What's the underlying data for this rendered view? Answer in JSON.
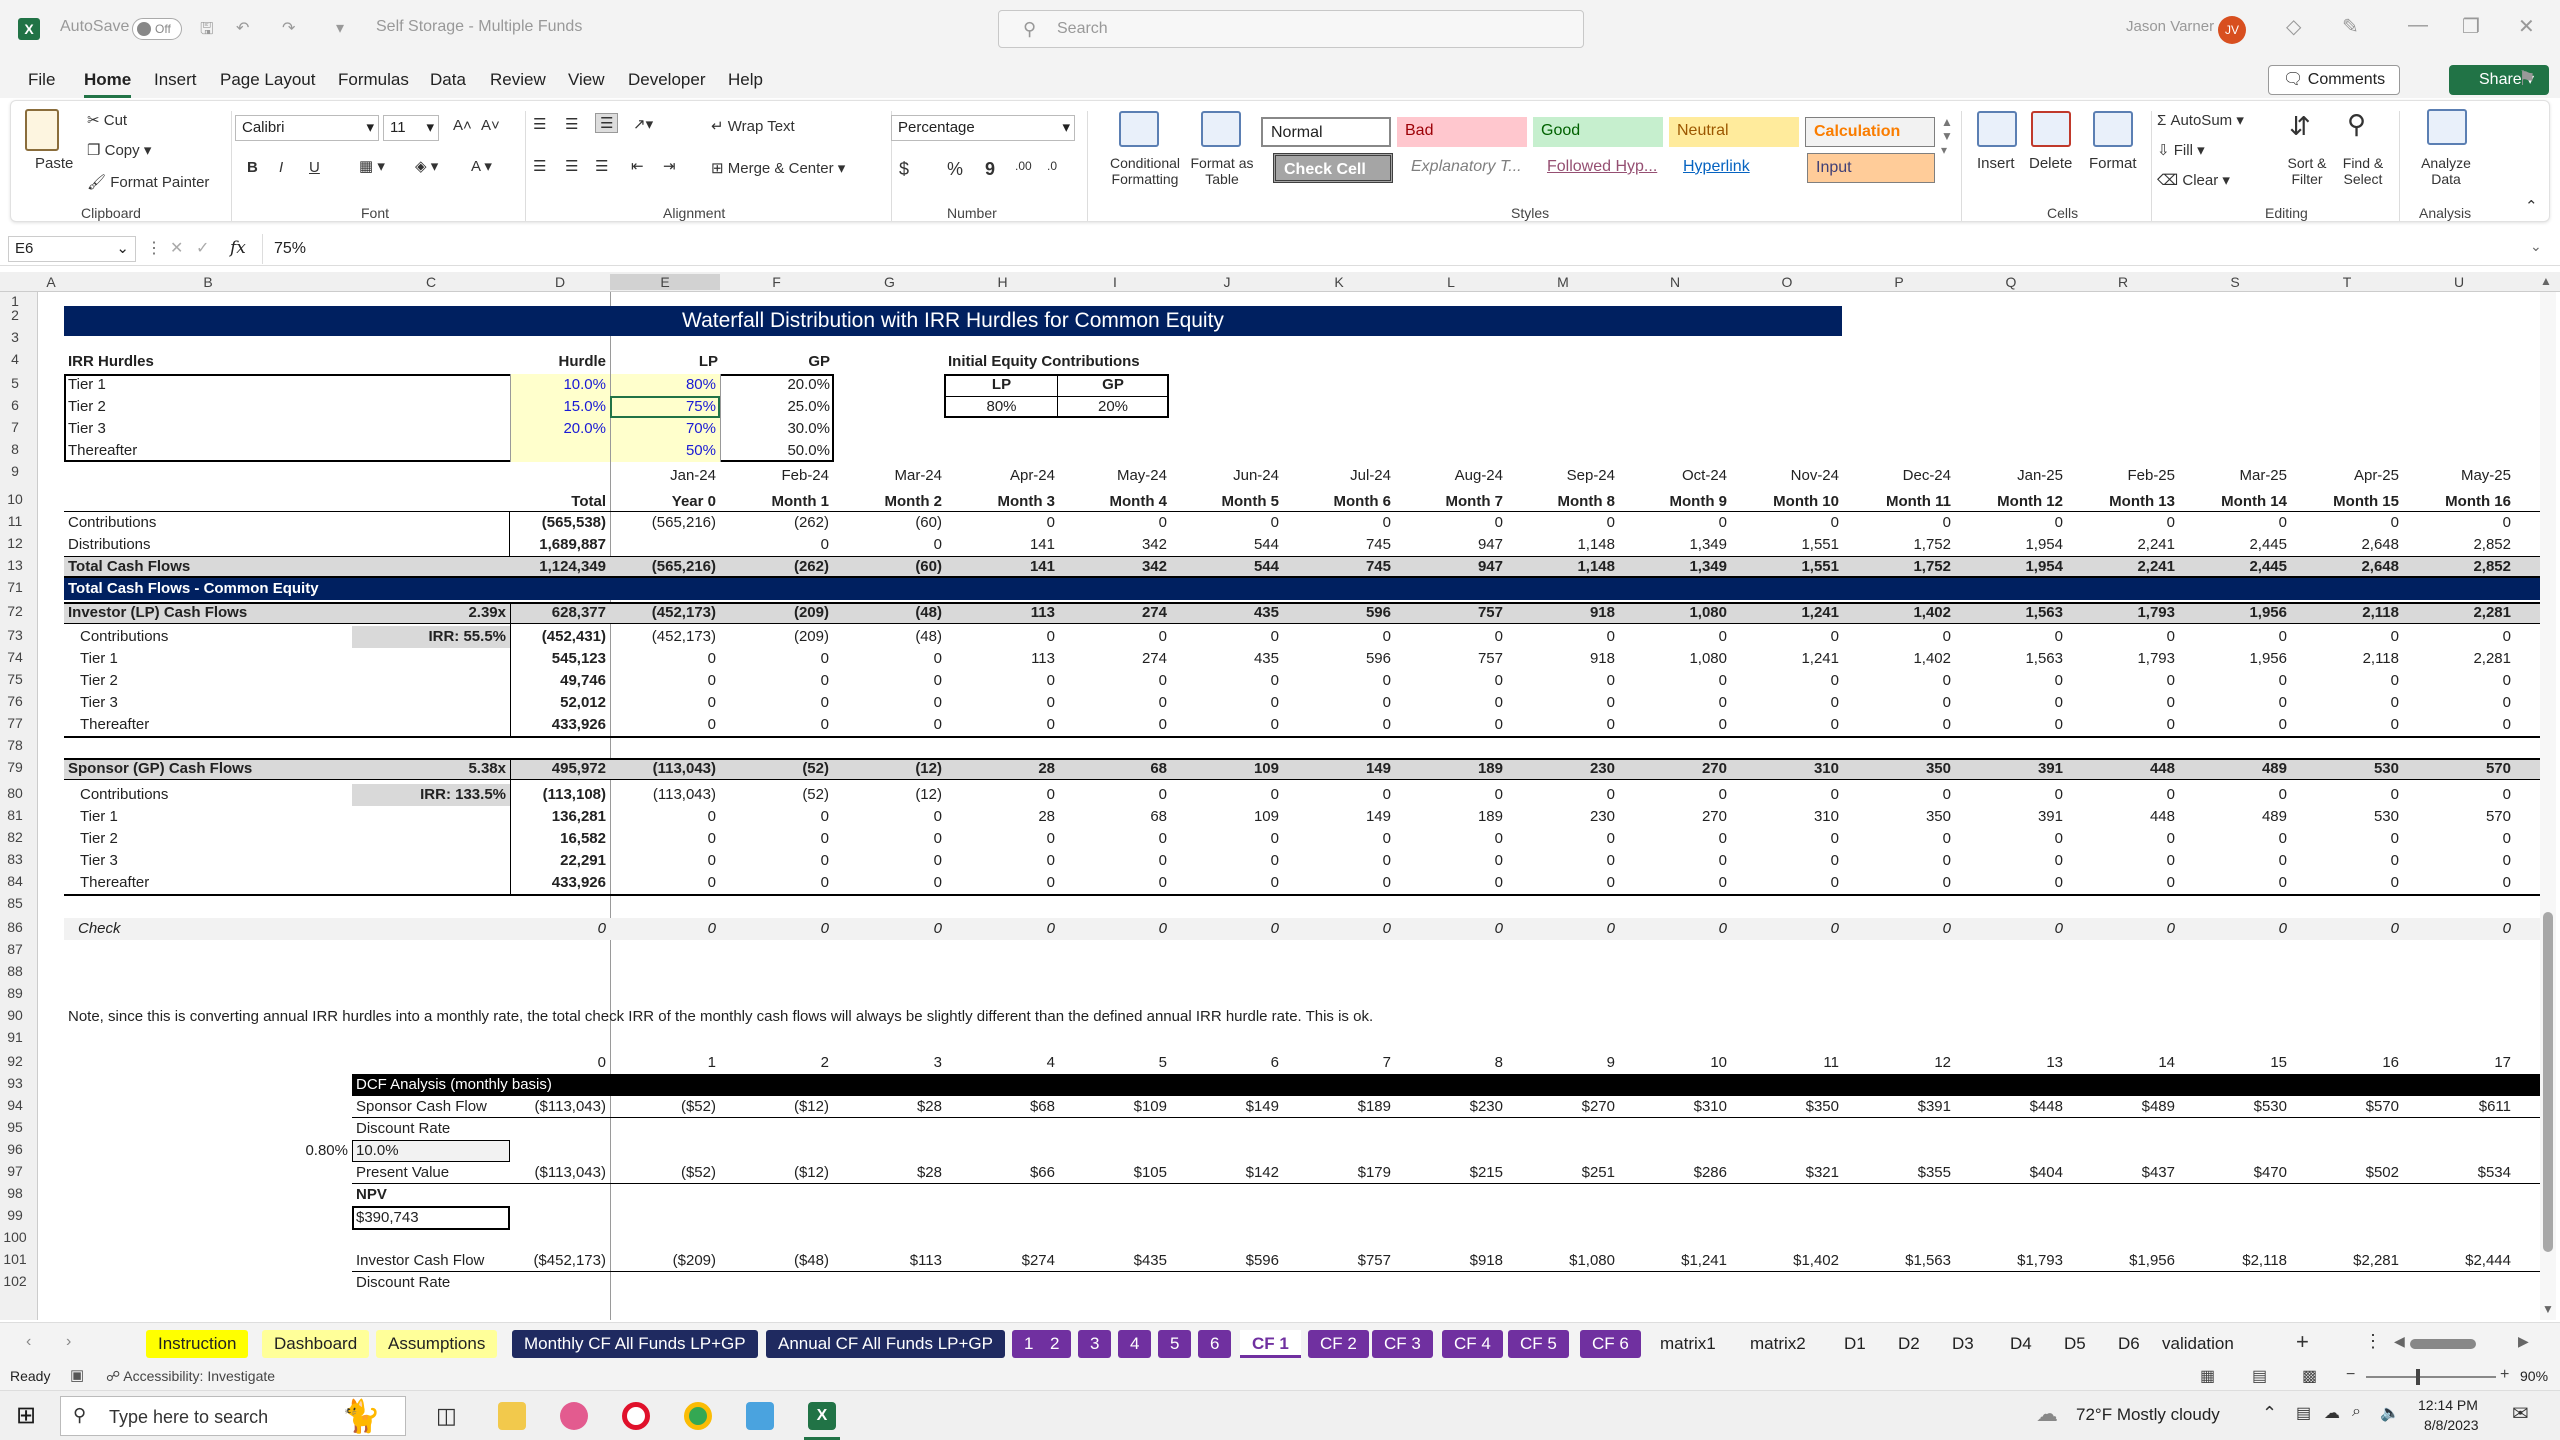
{
  "titlebar": {
    "autosave": "AutoSave",
    "autosave_state": "Off",
    "doc_title": "Self Storage - Multiple Funds",
    "search_placeholder": "Search",
    "user_name": "Jason Varner",
    "user_initials": "JV"
  },
  "menu": [
    "File",
    "Home",
    "Insert",
    "Page Layout",
    "Formulas",
    "Data",
    "Review",
    "View",
    "Developer",
    "Help"
  ],
  "menu_active": "Home",
  "comments_label": "Comments",
  "share_label": "Share",
  "ribbon": {
    "clipboard": {
      "paste": "Paste",
      "cut": "Cut",
      "copy": "Copy",
      "format_painter": "Format Painter",
      "group": "Clipboard"
    },
    "font": {
      "name": "Calibri",
      "size": "11",
      "bold": "B",
      "italic": "I",
      "underline": "U",
      "group": "Font"
    },
    "alignment": {
      "wrap": "Wrap Text",
      "merge": "Merge & Center",
      "group": "Alignment"
    },
    "number": {
      "format": "Percentage",
      "currency": "$",
      "percent": "%",
      "comma": "9",
      "group": "Number"
    },
    "styles": {
      "cond": "Conditional Formatting",
      "as_table": "Format as Table",
      "cells": [
        "Normal",
        "Bad",
        "Good",
        "Neutral",
        "Calculation",
        "Check Cell",
        "Explanatory T...",
        "Followed Hyp...",
        "Hyperlink",
        "Input"
      ],
      "group": "Styles"
    },
    "cells_group": {
      "insert": "Insert",
      "delete": "Delete",
      "format": "Format",
      "group": "Cells"
    },
    "editing": {
      "autosum": "AutoSum",
      "fill": "Fill",
      "clear": "Clear",
      "sort": "Sort & Filter",
      "find": "Find & Select",
      "group": "Editing"
    },
    "analysis": {
      "analyze": "Analyze Data",
      "group": "Analysis"
    }
  },
  "formula_bar": {
    "cell_ref": "E6",
    "fx": "fx",
    "value": "75%"
  },
  "columns": [
    "A",
    "B",
    "C",
    "D",
    "E",
    "F",
    "G",
    "H",
    "I",
    "J",
    "K",
    "L",
    "M",
    "N",
    "O",
    "P",
    "Q",
    "R",
    "S",
    "T",
    "U"
  ],
  "rows": [
    "1",
    "2",
    "3",
    "4",
    "5",
    "6",
    "7",
    "8",
    "9",
    "10",
    "11",
    "12",
    "13",
    "71",
    "72",
    "73",
    "74",
    "75",
    "76",
    "77",
    "78",
    "79",
    "80",
    "81",
    "82",
    "83",
    "84",
    "85",
    "86",
    "87",
    "88",
    "89",
    "90",
    "91",
    "92",
    "93",
    "94",
    "95",
    "96",
    "97",
    "98",
    "99",
    "100",
    "101",
    "102"
  ],
  "sheet": {
    "title": "Waterfall Distribution with IRR Hurdles for Common Equity",
    "hurdles": {
      "header": [
        "IRR Hurdles",
        "Hurdle",
        "LP",
        "GP"
      ],
      "rows": [
        [
          "Tier 1",
          "10.0%",
          "80%",
          "20.0%"
        ],
        [
          "Tier 2",
          "15.0%",
          "75%",
          "25.0%"
        ],
        [
          "Tier 3",
          "20.0%",
          "70%",
          "30.0%"
        ],
        [
          "Thereafter",
          "",
          "50%",
          "50.0%"
        ]
      ]
    },
    "initial_equity": {
      "title": "Initial Equity Contributions",
      "lp": "LP",
      "gp": "GP",
      "lp_val": "80%",
      "gp_val": "20%"
    },
    "months": [
      "Jan-24",
      "Feb-24",
      "Mar-24",
      "Apr-24",
      "May-24",
      "Jun-24",
      "Jul-24",
      "Aug-24",
      "Sep-24",
      "Oct-24",
      "Nov-24",
      "Dec-24",
      "Jan-25",
      "Feb-25",
      "Mar-25",
      "Apr-25",
      "May-25"
    ],
    "periods": [
      "Year 0",
      "Month 1",
      "Month 2",
      "Month 3",
      "Month 4",
      "Month 5",
      "Month 6",
      "Month 7",
      "Month 8",
      "Month 9",
      "Month 10",
      "Month 11",
      "Month 12",
      "Month 13",
      "Month 14",
      "Month 15",
      "Month 16"
    ],
    "total_label": "Total",
    "cf_rows": [
      {
        "label": "Contributions",
        "total": "(565,538)",
        "vals": [
          "(565,216)",
          "(262)",
          "(60)",
          "0",
          "0",
          "0",
          "0",
          "0",
          "0",
          "0",
          "0",
          "0",
          "0",
          "0",
          "0",
          "0",
          "0"
        ]
      },
      {
        "label": "Distributions",
        "total": "1,689,887",
        "vals": [
          "",
          "0",
          "0",
          "141",
          "342",
          "544",
          "745",
          "947",
          "1,148",
          "1,349",
          "1,551",
          "1,752",
          "1,954",
          "2,241",
          "2,445",
          "2,648",
          "2,852"
        ]
      },
      {
        "label": "Total Cash Flows",
        "total": "1,124,349",
        "vals": [
          "(565,216)",
          "(262)",
          "(60)",
          "141",
          "342",
          "544",
          "745",
          "947",
          "1,148",
          "1,349",
          "1,551",
          "1,752",
          "1,954",
          "2,241",
          "2,445",
          "2,648",
          "2,852"
        ]
      }
    ],
    "common_equity_header": "Total Cash Flows - Common Equity",
    "lp": {
      "label": "Investor (LP) Cash Flows",
      "multiple": "2.39x",
      "irr": "IRR: 55.5%",
      "total": "628,377",
      "vals": [
        "(452,173)",
        "(209)",
        "(48)",
        "113",
        "274",
        "435",
        "596",
        "757",
        "918",
        "1,080",
        "1,241",
        "1,402",
        "1,563",
        "1,793",
        "1,956",
        "2,118",
        "2,281"
      ],
      "rows": [
        {
          "label": "Contributions",
          "total": "(452,431)",
          "vals": [
            "(452,173)",
            "(209)",
            "(48)",
            "0",
            "0",
            "0",
            "0",
            "0",
            "0",
            "0",
            "0",
            "0",
            "0",
            "0",
            "0",
            "0",
            "0"
          ]
        },
        {
          "label": "Tier 1",
          "total": "545,123",
          "vals": [
            "0",
            "0",
            "0",
            "113",
            "274",
            "435",
            "596",
            "757",
            "918",
            "1,080",
            "1,241",
            "1,402",
            "1,563",
            "1,793",
            "1,956",
            "2,118",
            "2,281"
          ]
        },
        {
          "label": "Tier 2",
          "total": "49,746",
          "vals": [
            "0",
            "0",
            "0",
            "0",
            "0",
            "0",
            "0",
            "0",
            "0",
            "0",
            "0",
            "0",
            "0",
            "0",
            "0",
            "0",
            "0"
          ]
        },
        {
          "label": "Tier 3",
          "total": "52,012",
          "vals": [
            "0",
            "0",
            "0",
            "0",
            "0",
            "0",
            "0",
            "0",
            "0",
            "0",
            "0",
            "0",
            "0",
            "0",
            "0",
            "0",
            "0"
          ]
        },
        {
          "label": "Thereafter",
          "total": "433,926",
          "vals": [
            "0",
            "0",
            "0",
            "0",
            "0",
            "0",
            "0",
            "0",
            "0",
            "0",
            "0",
            "0",
            "0",
            "0",
            "0",
            "0",
            "0"
          ]
        }
      ]
    },
    "gp": {
      "label": "Sponsor (GP) Cash Flows",
      "multiple": "5.38x",
      "irr": "IRR: 133.5%",
      "total": "495,972",
      "vals": [
        "(113,043)",
        "(52)",
        "(12)",
        "28",
        "68",
        "109",
        "149",
        "189",
        "230",
        "270",
        "310",
        "350",
        "391",
        "448",
        "489",
        "530",
        "570"
      ],
      "rows": [
        {
          "label": "Contributions",
          "total": "(113,108)",
          "vals": [
            "(113,043)",
            "(52)",
            "(12)",
            "0",
            "0",
            "0",
            "0",
            "0",
            "0",
            "0",
            "0",
            "0",
            "0",
            "0",
            "0",
            "0",
            "0"
          ]
        },
        {
          "label": "Tier 1",
          "total": "136,281",
          "vals": [
            "0",
            "0",
            "0",
            "28",
            "68",
            "109",
            "149",
            "189",
            "230",
            "270",
            "310",
            "350",
            "391",
            "448",
            "489",
            "530",
            "570"
          ]
        },
        {
          "label": "Tier 2",
          "total": "16,582",
          "vals": [
            "0",
            "0",
            "0",
            "0",
            "0",
            "0",
            "0",
            "0",
            "0",
            "0",
            "0",
            "0",
            "0",
            "0",
            "0",
            "0",
            "0"
          ]
        },
        {
          "label": "Tier 3",
          "total": "22,291",
          "vals": [
            "0",
            "0",
            "0",
            "0",
            "0",
            "0",
            "0",
            "0",
            "0",
            "0",
            "0",
            "0",
            "0",
            "0",
            "0",
            "0",
            "0"
          ]
        },
        {
          "label": "Thereafter",
          "total": "433,926",
          "vals": [
            "0",
            "0",
            "0",
            "0",
            "0",
            "0",
            "0",
            "0",
            "0",
            "0",
            "0",
            "0",
            "0",
            "0",
            "0",
            "0",
            "0"
          ]
        }
      ]
    },
    "check": {
      "label": "Check",
      "total": "0",
      "vals": [
        "0",
        "0",
        "0",
        "0",
        "0",
        "0",
        "0",
        "0",
        "0",
        "0",
        "0",
        "0",
        "0",
        "0",
        "0",
        "0",
        "0"
      ]
    },
    "note": "Note, since this is converting annual IRR hurdles into a monthly rate, the total check IRR of the monthly cash flows will always be slightly different than the defined annual IRR hurdle rate. This is ok.",
    "dcf": {
      "period_nums": [
        "0",
        "1",
        "2",
        "3",
        "4",
        "5",
        "6",
        "7",
        "8",
        "9",
        "10",
        "11",
        "12",
        "13",
        "14",
        "15",
        "16",
        "17"
      ],
      "header": "DCF Analysis (monthly basis)",
      "sponsor_label": "Sponsor Cash Flow",
      "sponsor_vals": [
        "($113,043)",
        "($52)",
        "($12)",
        "$28",
        "$68",
        "$109",
        "$149",
        "$189",
        "$230",
        "$270",
        "$310",
        "$350",
        "$391",
        "$448",
        "$489",
        "$530",
        "$570",
        "$611"
      ],
      "discount_label": "Discount Rate",
      "monthly_rate": "0.80%",
      "discount_val": "10.0%",
      "pv_label": "Present Value",
      "pv_vals": [
        "($113,043)",
        "($52)",
        "($12)",
        "$28",
        "$66",
        "$105",
        "$142",
        "$179",
        "$215",
        "$251",
        "$286",
        "$321",
        "$355",
        "$404",
        "$437",
        "$470",
        "$502",
        "$534"
      ],
      "npv_label": "NPV",
      "npv_val": "$390,743",
      "investor_label": "Investor Cash Flow",
      "investor_vals": [
        "($452,173)",
        "($209)",
        "($48)",
        "$113",
        "$274",
        "$435",
        "$596",
        "$757",
        "$918",
        "$1,080",
        "$1,241",
        "$1,402",
        "$1,563",
        "$1,793",
        "$1,956",
        "$2,118",
        "$2,281",
        "$2,444"
      ],
      "discount_label2": "Discount Rate"
    }
  },
  "sheet_tabs": [
    {
      "label": "Instruction",
      "bg": "#ffff00",
      "fg": "#222"
    },
    {
      "label": "Dashboard",
      "bg": "#ffff99",
      "fg": "#222"
    },
    {
      "label": "Assumptions",
      "bg": "#ffff99",
      "fg": "#222"
    },
    {
      "label": "Monthly CF All Funds LP+GP",
      "bg": "#1f2a60",
      "fg": "#fff"
    },
    {
      "label": "Annual CF All Funds LP+GP",
      "bg": "#1f2a60",
      "fg": "#fff"
    },
    {
      "label": "1",
      "bg": "#7030a0",
      "fg": "#fff"
    },
    {
      "label": "2",
      "bg": "#7030a0",
      "fg": "#fff"
    },
    {
      "label": "3",
      "bg": "#7030a0",
      "fg": "#fff"
    },
    {
      "label": "4",
      "bg": "#7030a0",
      "fg": "#fff"
    },
    {
      "label": "5",
      "bg": "#7030a0",
      "fg": "#fff"
    },
    {
      "label": "6",
      "bg": "#7030a0",
      "fg": "#fff"
    },
    {
      "label": "CF 1",
      "bg": "#ffffff",
      "fg": "#7030a0"
    },
    {
      "label": "CF 2",
      "bg": "#7030a0",
      "fg": "#fff"
    },
    {
      "label": "CF 3",
      "bg": "#7030a0",
      "fg": "#fff"
    },
    {
      "label": "CF 4",
      "bg": "#7030a0",
      "fg": "#fff"
    },
    {
      "label": "CF 5",
      "bg": "#7030a0",
      "fg": "#fff"
    },
    {
      "label": "CF 6",
      "bg": "#7030a0",
      "fg": "#fff"
    },
    {
      "label": "matrix1",
      "bg": "transparent",
      "fg": "#222"
    },
    {
      "label": "matrix2",
      "bg": "transparent",
      "fg": "#222"
    },
    {
      "label": "D1",
      "bg": "transparent",
      "fg": "#222"
    },
    {
      "label": "D2",
      "bg": "transparent",
      "fg": "#222"
    },
    {
      "label": "D3",
      "bg": "transparent",
      "fg": "#222"
    },
    {
      "label": "D4",
      "bg": "transparent",
      "fg": "#222"
    },
    {
      "label": "D5",
      "bg": "transparent",
      "fg": "#222"
    },
    {
      "label": "D6",
      "bg": "transparent",
      "fg": "#222"
    },
    {
      "label": "validation",
      "bg": "transparent",
      "fg": "#222"
    }
  ],
  "status": {
    "ready": "Ready",
    "accessibility": "Accessibility: Investigate",
    "zoom": "90%"
  },
  "taskbar": {
    "search_placeholder": "Type here to search",
    "weather": "72°F  Mostly cloudy",
    "time": "12:14 PM",
    "date": "8/8/2023"
  }
}
